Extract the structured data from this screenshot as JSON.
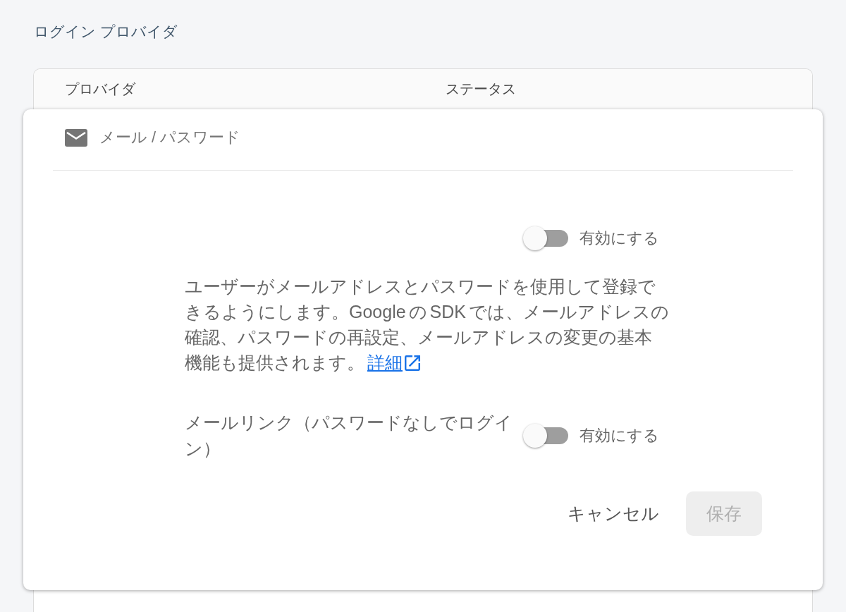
{
  "page_title": "ログイン プロバイダ",
  "table": {
    "columns": [
      "プロバイダ",
      "ステータス"
    ],
    "provider": {
      "name": "メール / パスワード",
      "enable_toggle": {
        "on": false,
        "label": "有効にする"
      },
      "description": "ユーザーがメールアドレスとパスワードを使用して登録できるようにします。Google の SDK では、メールアドレスの確認、パスワードの再設定、メールアドレスの変更の基本機能も提供されます。",
      "details_link": "詳細",
      "email_link": {
        "label": "メールリンク（パスワードなしでログイン）",
        "toggle": {
          "on": false,
          "label": "有効にする"
        }
      },
      "buttons": [
        {
          "label": "キャンセル",
          "kind": "text",
          "disabled": false
        },
        {
          "label": "保存",
          "kind": "filled",
          "disabled": true
        }
      ]
    }
  }
}
